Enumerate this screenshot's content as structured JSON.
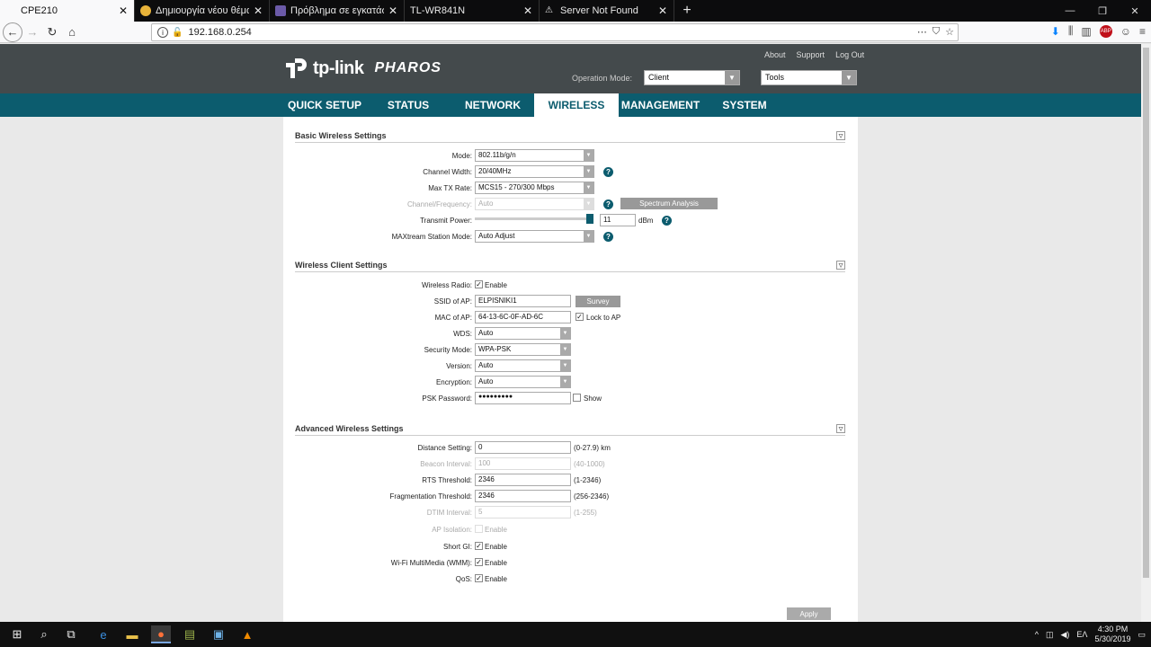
{
  "browser": {
    "tabs": [
      {
        "title": "CPE210",
        "active": true,
        "icon_color": "#f9f9fa"
      },
      {
        "title": "Δημιουργία νέου θέματος",
        "active": false,
        "icon_color": "#e8b33a"
      },
      {
        "title": "Πρόβλημα σε εγκατάσταση tp",
        "active": false,
        "icon_color": "#6b5aa8"
      },
      {
        "title": "TL-WR841N",
        "active": false,
        "icon_color": "#0c0c0d"
      },
      {
        "title": "Server Not Found",
        "active": false,
        "icon_color": "#0c0c0d"
      }
    ],
    "url": "192.168.0.254"
  },
  "header": {
    "brand": "tp-link",
    "product": "PHAROS",
    "links": [
      "About",
      "Support",
      "Log Out"
    ],
    "operation_mode_label": "Operation Mode:",
    "operation_mode_value": "Client",
    "tools_value": "Tools"
  },
  "menu": [
    "QUICK SETUP",
    "STATUS",
    "NETWORK",
    "WIRELESS",
    "MANAGEMENT",
    "SYSTEM"
  ],
  "basic": {
    "title": "Basic Wireless Settings",
    "mode_label": "Mode:",
    "mode_value": "802.11b/g/n",
    "width_label": "Channel Width:",
    "width_value": "20/40MHz",
    "txrate_label": "Max TX Rate:",
    "txrate_value": "MCS15 - 270/300 Mbps",
    "freq_label": "Channel/Frequency:",
    "freq_value": "Auto",
    "spectrum_button": "Spectrum Analysis",
    "power_label": "Transmit Power:",
    "power_value": "11",
    "power_unit": "dBm",
    "power_level": 1.0,
    "maxtream_label": "MAXtream Station Mode:",
    "maxtream_value": "Auto Adjust"
  },
  "client": {
    "title": "Wireless Client Settings",
    "radio_label": "Wireless Radio:",
    "radio_check": "Enable",
    "ssid_label": "SSID of AP:",
    "ssid_value": "ELPISNIKI1",
    "survey_button": "Survey",
    "mac_label": "MAC of AP:",
    "mac_value": "64-13-6C-0F-AD-6C",
    "lock_label": "Lock to AP",
    "wds_label": "WDS:",
    "wds_value": "Auto",
    "security_label": "Security Mode:",
    "security_value": "WPA-PSK",
    "version_label": "Version:",
    "version_value": "Auto",
    "encryption_label": "Encryption:",
    "encryption_value": "Auto",
    "psk_label": "PSK Password:",
    "psk_value": "●●●●●●●●●",
    "show_label": "Show"
  },
  "advanced": {
    "title": "Advanced Wireless Settings",
    "distance_label": "Distance Setting:",
    "distance_value": "0",
    "distance_hint": "(0-27.9) km",
    "beacon_label": "Beacon Interval:",
    "beacon_value": "100",
    "beacon_hint": "(40-1000)",
    "rts_label": "RTS Threshold:",
    "rts_value": "2346",
    "rts_hint": "(1-2346)",
    "frag_label": "Fragmentation Threshold:",
    "frag_value": "2346",
    "frag_hint": "(256-2346)",
    "dtim_label": "DTIM Interval:",
    "dtim_value": "5",
    "dtim_hint": "(1-255)",
    "ap_iso_label": "AP Isolation:",
    "ap_iso_check": "Enable",
    "shortgi_label": "Short GI:",
    "shortgi_check": "Enable",
    "wmm_label": "Wi-Fi MultiMedia (WMM):",
    "wmm_check": "Enable",
    "qos_label": "QoS:",
    "qos_check": "Enable"
  },
  "apply_button": "Apply",
  "taskbar": {
    "lang": "ΕΛ",
    "time": "4:30 PM",
    "date": "5/30/2019"
  },
  "colors": {
    "accent": "#0c5c6e",
    "header_bg": "#444a4c"
  }
}
